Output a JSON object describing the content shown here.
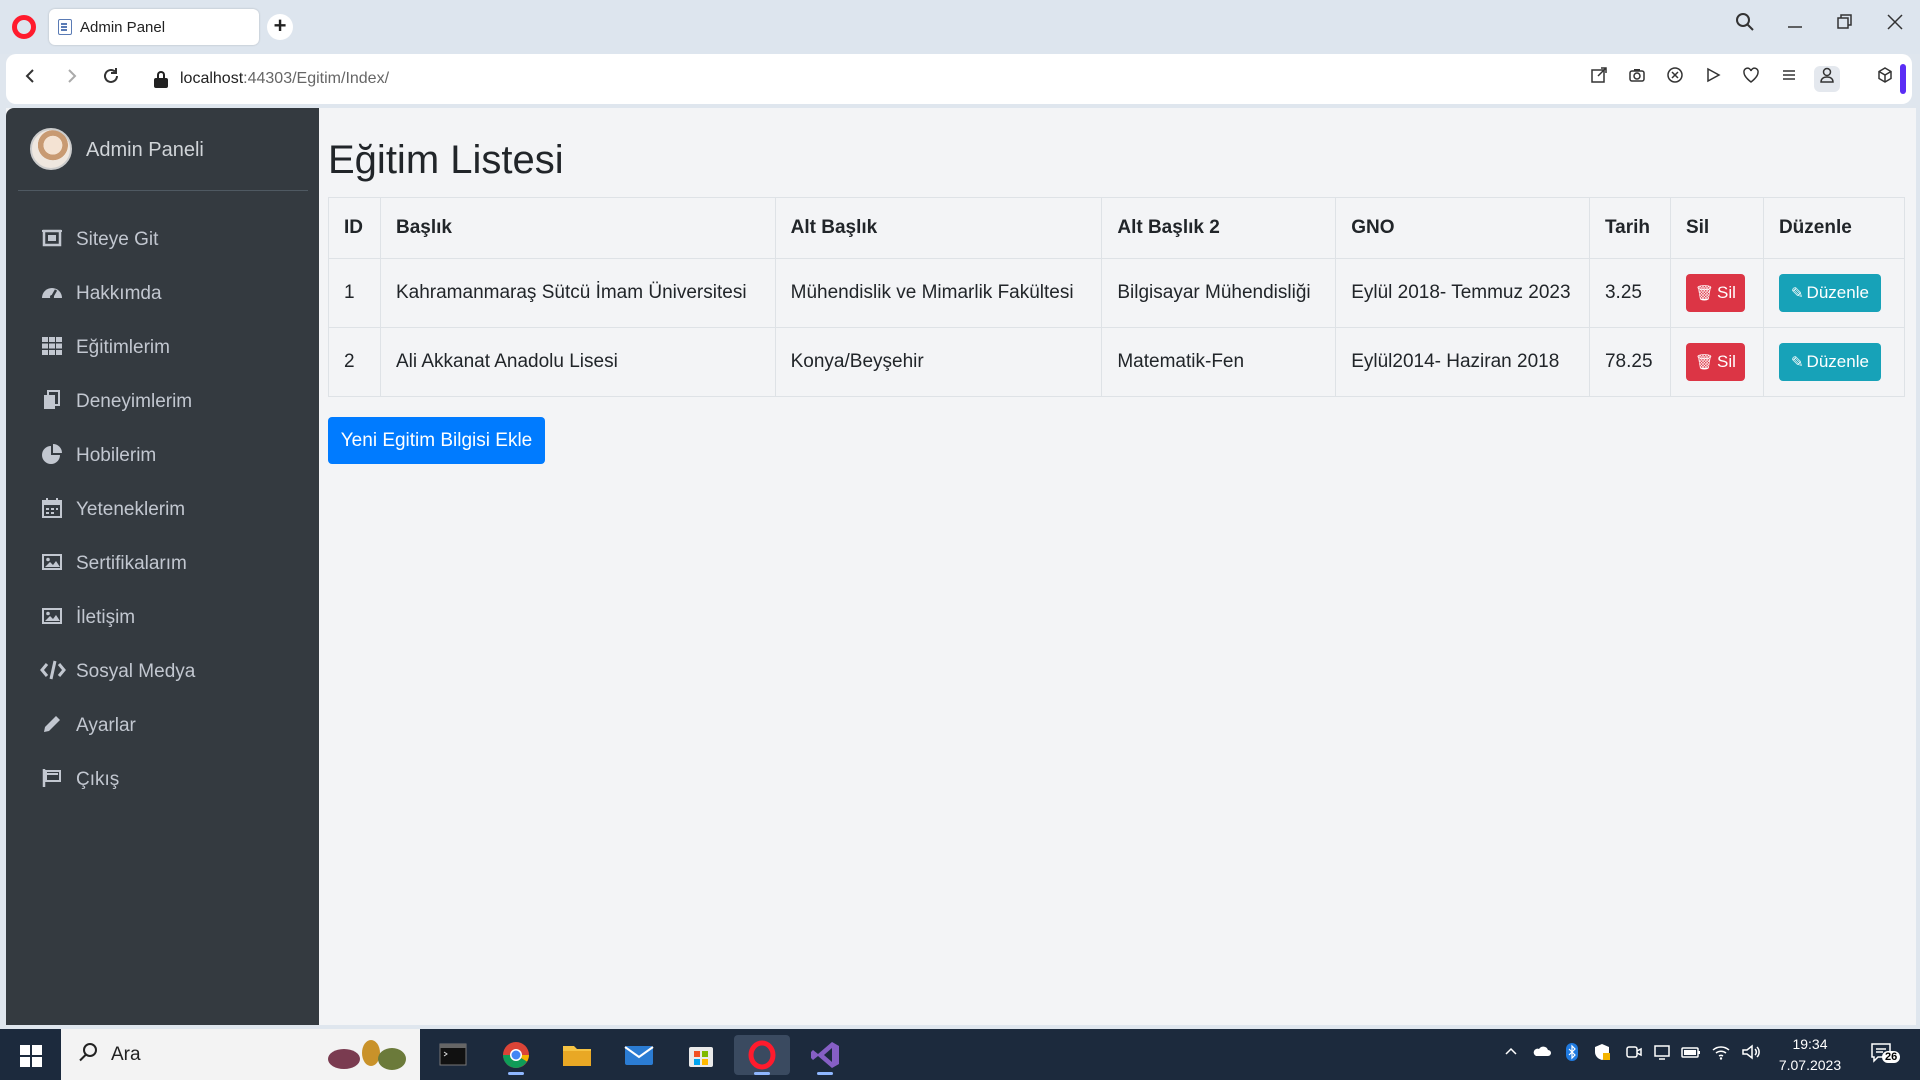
{
  "browser": {
    "tab_title": "Admin Panel",
    "url_host": "localhost",
    "url_rest": ":44303/Egitim/Index/"
  },
  "sidebar": {
    "brand": "Admin Paneli",
    "items": [
      {
        "label": "Siteye Git",
        "icon": "home-icon"
      },
      {
        "label": "Hakkımda",
        "icon": "tachometer-icon"
      },
      {
        "label": "Eğitimlerim",
        "icon": "grid-icon"
      },
      {
        "label": "Deneyimlerim",
        "icon": "copy-icon"
      },
      {
        "label": "Hobilerim",
        "icon": "pie-chart-icon"
      },
      {
        "label": "Yeteneklerim",
        "icon": "calendar-icon"
      },
      {
        "label": "Sertifikalarım",
        "icon": "image-icon"
      },
      {
        "label": "İletişim",
        "icon": "image-icon"
      },
      {
        "label": "Sosyal Medya",
        "icon": "code-icon"
      },
      {
        "label": "Ayarlar",
        "icon": "pencil-icon"
      },
      {
        "label": "Çıkış",
        "icon": "flag-icon"
      }
    ]
  },
  "main": {
    "title": "Eğitim Listesi",
    "table": {
      "headers": [
        "ID",
        "Başlık",
        "Alt Başlık",
        "Alt Başlık 2",
        "GNO",
        "Tarih",
        "Sil",
        "Düzenle"
      ],
      "rows": [
        {
          "id": "1",
          "baslik": "Kahramanmaraş Sütcü İmam Üniversitesi",
          "alt_baslik": "Mühendislik ve Mimarlik Fakültesi",
          "alt_baslik2": "Bilgisayar Mühendisliği",
          "gno": "Eylül 2018- Temmuz 2023",
          "tarih": "3.25"
        },
        {
          "id": "2",
          "baslik": "Ali Akkanat Anadolu Lisesi",
          "alt_baslik": "Konya/Beyşehir",
          "alt_baslik2": "Matematik-Fen",
          "gno": "Eylül2014- Haziran 2018",
          "tarih": "78.25"
        }
      ],
      "delete_label": "Sil",
      "edit_label": "Düzenle"
    },
    "add_button": "Yeni Egitim Bilgisi Ekle"
  },
  "taskbar": {
    "search_text": "Ara",
    "time": "19:34",
    "date": "7.07.2023",
    "notification_count": "26"
  },
  "colors": {
    "sidebar_bg": "#343a40",
    "danger": "#dc3545",
    "info": "#17a2b8",
    "primary": "#007bff"
  }
}
